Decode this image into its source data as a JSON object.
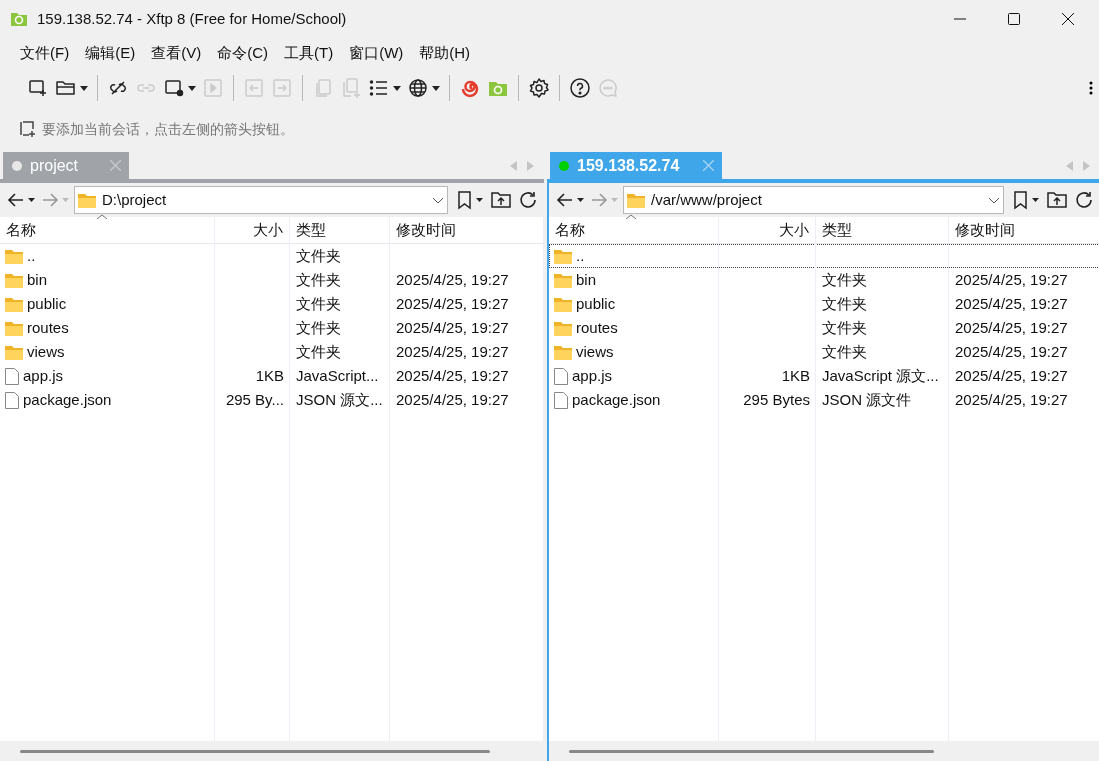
{
  "window": {
    "title": "159.138.52.74 - Xftp 8 (Free for Home/School)"
  },
  "menu": [
    "文件(F)",
    "编辑(E)",
    "查看(V)",
    "命令(C)",
    "工具(T)",
    "窗口(W)",
    "帮助(H)"
  ],
  "toolbar": [
    [
      {
        "kind": "new-session",
        "disabled": false,
        "menu": false
      },
      {
        "kind": "open-folder",
        "disabled": false,
        "menu": true
      }
    ],
    [
      {
        "kind": "unlink",
        "disabled": false,
        "menu": false
      },
      {
        "kind": "link",
        "disabled": true,
        "menu": false
      },
      {
        "kind": "new-window",
        "disabled": false,
        "menu": true
      },
      {
        "kind": "play",
        "disabled": true,
        "menu": false
      }
    ],
    [
      {
        "kind": "arrow-in",
        "disabled": true,
        "menu": false
      },
      {
        "kind": "arrow-out",
        "disabled": true,
        "menu": false
      }
    ],
    [
      {
        "kind": "copy",
        "disabled": true,
        "menu": false
      },
      {
        "kind": "copy-add",
        "disabled": true,
        "menu": false
      },
      {
        "kind": "list",
        "disabled": false,
        "menu": true
      },
      {
        "kind": "globe",
        "disabled": false,
        "menu": true
      }
    ],
    [
      {
        "kind": "swirl",
        "disabled": false,
        "menu": false
      },
      {
        "kind": "app",
        "disabled": false,
        "menu": false
      }
    ],
    [
      {
        "kind": "gear",
        "disabled": false,
        "menu": false
      }
    ],
    [
      {
        "kind": "help",
        "disabled": false,
        "menu": false
      },
      {
        "kind": "chat",
        "disabled": true,
        "menu": false
      }
    ]
  ],
  "hint": "要添加当前会话，点击左侧的箭头按钮。",
  "panes": [
    {
      "tab": {
        "label": "project",
        "selected": false,
        "connected": false
      },
      "path": "D:\\project",
      "columns": [
        "名称",
        "大小",
        "类型",
        "修改时间"
      ],
      "rows": [
        {
          "kind": "folder",
          "name": "..",
          "size": "",
          "type": "文件夹",
          "modified": "",
          "focused": false
        },
        {
          "kind": "folder",
          "name": "bin",
          "size": "",
          "type": "文件夹",
          "modified": "2025/4/25, 19:27",
          "focused": false
        },
        {
          "kind": "folder",
          "name": "public",
          "size": "",
          "type": "文件夹",
          "modified": "2025/4/25, 19:27",
          "focused": false
        },
        {
          "kind": "folder",
          "name": "routes",
          "size": "",
          "type": "文件夹",
          "modified": "2025/4/25, 19:27",
          "focused": false
        },
        {
          "kind": "folder",
          "name": "views",
          "size": "",
          "type": "文件夹",
          "modified": "2025/4/25, 19:27",
          "focused": false
        },
        {
          "kind": "js",
          "name": "app.js",
          "size": "1KB",
          "type": "JavaScript...",
          "modified": "2025/4/25, 19:27",
          "focused": false
        },
        {
          "kind": "json",
          "name": "package.json",
          "size": "295 By...",
          "type": "JSON 源文...",
          "modified": "2025/4/25, 19:27",
          "focused": false
        }
      ]
    },
    {
      "tab": {
        "label": "159.138.52.74",
        "selected": true,
        "connected": true
      },
      "path": "/var/www/project",
      "columns": [
        "名称",
        "大小",
        "类型",
        "修改时间"
      ],
      "rows": [
        {
          "kind": "folder",
          "name": "..",
          "size": "",
          "type": "",
          "modified": "",
          "focused": true
        },
        {
          "kind": "folder",
          "name": "bin",
          "size": "",
          "type": "文件夹",
          "modified": "2025/4/25, 19:27",
          "focused": false
        },
        {
          "kind": "folder",
          "name": "public",
          "size": "",
          "type": "文件夹",
          "modified": "2025/4/25, 19:27",
          "focused": false
        },
        {
          "kind": "folder",
          "name": "routes",
          "size": "",
          "type": "文件夹",
          "modified": "2025/4/25, 19:27",
          "focused": false
        },
        {
          "kind": "folder",
          "name": "views",
          "size": "",
          "type": "文件夹",
          "modified": "2025/4/25, 19:27",
          "focused": false
        },
        {
          "kind": "js",
          "name": "app.js",
          "size": "1KB",
          "type": "JavaScript 源文...",
          "modified": "2025/4/25, 19:27",
          "focused": false
        },
        {
          "kind": "json",
          "name": "package.json",
          "size": "295 Bytes",
          "type": "JSON 源文件",
          "modified": "2025/4/25, 19:27",
          "focused": false
        }
      ]
    }
  ]
}
